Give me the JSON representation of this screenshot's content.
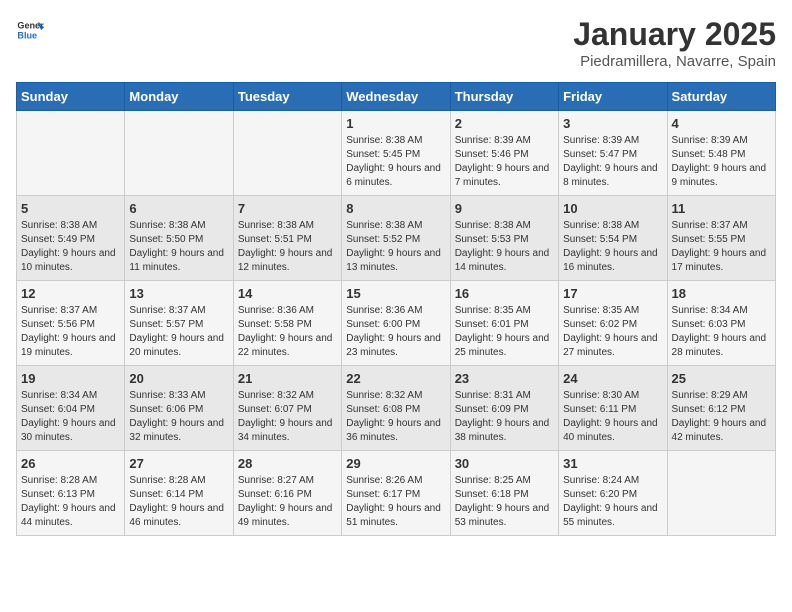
{
  "header": {
    "logo_general": "General",
    "logo_blue": "Blue",
    "title": "January 2025",
    "subtitle": "Piedramillera, Navarre, Spain"
  },
  "days_of_week": [
    "Sunday",
    "Monday",
    "Tuesday",
    "Wednesday",
    "Thursday",
    "Friday",
    "Saturday"
  ],
  "weeks": [
    [
      {
        "day": "",
        "sunrise": "",
        "sunset": "",
        "daylight": ""
      },
      {
        "day": "",
        "sunrise": "",
        "sunset": "",
        "daylight": ""
      },
      {
        "day": "",
        "sunrise": "",
        "sunset": "",
        "daylight": ""
      },
      {
        "day": "1",
        "sunrise": "Sunrise: 8:38 AM",
        "sunset": "Sunset: 5:45 PM",
        "daylight": "Daylight: 9 hours and 6 minutes."
      },
      {
        "day": "2",
        "sunrise": "Sunrise: 8:39 AM",
        "sunset": "Sunset: 5:46 PM",
        "daylight": "Daylight: 9 hours and 7 minutes."
      },
      {
        "day": "3",
        "sunrise": "Sunrise: 8:39 AM",
        "sunset": "Sunset: 5:47 PM",
        "daylight": "Daylight: 9 hours and 8 minutes."
      },
      {
        "day": "4",
        "sunrise": "Sunrise: 8:39 AM",
        "sunset": "Sunset: 5:48 PM",
        "daylight": "Daylight: 9 hours and 9 minutes."
      }
    ],
    [
      {
        "day": "5",
        "sunrise": "Sunrise: 8:38 AM",
        "sunset": "Sunset: 5:49 PM",
        "daylight": "Daylight: 9 hours and 10 minutes."
      },
      {
        "day": "6",
        "sunrise": "Sunrise: 8:38 AM",
        "sunset": "Sunset: 5:50 PM",
        "daylight": "Daylight: 9 hours and 11 minutes."
      },
      {
        "day": "7",
        "sunrise": "Sunrise: 8:38 AM",
        "sunset": "Sunset: 5:51 PM",
        "daylight": "Daylight: 9 hours and 12 minutes."
      },
      {
        "day": "8",
        "sunrise": "Sunrise: 8:38 AM",
        "sunset": "Sunset: 5:52 PM",
        "daylight": "Daylight: 9 hours and 13 minutes."
      },
      {
        "day": "9",
        "sunrise": "Sunrise: 8:38 AM",
        "sunset": "Sunset: 5:53 PM",
        "daylight": "Daylight: 9 hours and 14 minutes."
      },
      {
        "day": "10",
        "sunrise": "Sunrise: 8:38 AM",
        "sunset": "Sunset: 5:54 PM",
        "daylight": "Daylight: 9 hours and 16 minutes."
      },
      {
        "day": "11",
        "sunrise": "Sunrise: 8:37 AM",
        "sunset": "Sunset: 5:55 PM",
        "daylight": "Daylight: 9 hours and 17 minutes."
      }
    ],
    [
      {
        "day": "12",
        "sunrise": "Sunrise: 8:37 AM",
        "sunset": "Sunset: 5:56 PM",
        "daylight": "Daylight: 9 hours and 19 minutes."
      },
      {
        "day": "13",
        "sunrise": "Sunrise: 8:37 AM",
        "sunset": "Sunset: 5:57 PM",
        "daylight": "Daylight: 9 hours and 20 minutes."
      },
      {
        "day": "14",
        "sunrise": "Sunrise: 8:36 AM",
        "sunset": "Sunset: 5:58 PM",
        "daylight": "Daylight: 9 hours and 22 minutes."
      },
      {
        "day": "15",
        "sunrise": "Sunrise: 8:36 AM",
        "sunset": "Sunset: 6:00 PM",
        "daylight": "Daylight: 9 hours and 23 minutes."
      },
      {
        "day": "16",
        "sunrise": "Sunrise: 8:35 AM",
        "sunset": "Sunset: 6:01 PM",
        "daylight": "Daylight: 9 hours and 25 minutes."
      },
      {
        "day": "17",
        "sunrise": "Sunrise: 8:35 AM",
        "sunset": "Sunset: 6:02 PM",
        "daylight": "Daylight: 9 hours and 27 minutes."
      },
      {
        "day": "18",
        "sunrise": "Sunrise: 8:34 AM",
        "sunset": "Sunset: 6:03 PM",
        "daylight": "Daylight: 9 hours and 28 minutes."
      }
    ],
    [
      {
        "day": "19",
        "sunrise": "Sunrise: 8:34 AM",
        "sunset": "Sunset: 6:04 PM",
        "daylight": "Daylight: 9 hours and 30 minutes."
      },
      {
        "day": "20",
        "sunrise": "Sunrise: 8:33 AM",
        "sunset": "Sunset: 6:06 PM",
        "daylight": "Daylight: 9 hours and 32 minutes."
      },
      {
        "day": "21",
        "sunrise": "Sunrise: 8:32 AM",
        "sunset": "Sunset: 6:07 PM",
        "daylight": "Daylight: 9 hours and 34 minutes."
      },
      {
        "day": "22",
        "sunrise": "Sunrise: 8:32 AM",
        "sunset": "Sunset: 6:08 PM",
        "daylight": "Daylight: 9 hours and 36 minutes."
      },
      {
        "day": "23",
        "sunrise": "Sunrise: 8:31 AM",
        "sunset": "Sunset: 6:09 PM",
        "daylight": "Daylight: 9 hours and 38 minutes."
      },
      {
        "day": "24",
        "sunrise": "Sunrise: 8:30 AM",
        "sunset": "Sunset: 6:11 PM",
        "daylight": "Daylight: 9 hours and 40 minutes."
      },
      {
        "day": "25",
        "sunrise": "Sunrise: 8:29 AM",
        "sunset": "Sunset: 6:12 PM",
        "daylight": "Daylight: 9 hours and 42 minutes."
      }
    ],
    [
      {
        "day": "26",
        "sunrise": "Sunrise: 8:28 AM",
        "sunset": "Sunset: 6:13 PM",
        "daylight": "Daylight: 9 hours and 44 minutes."
      },
      {
        "day": "27",
        "sunrise": "Sunrise: 8:28 AM",
        "sunset": "Sunset: 6:14 PM",
        "daylight": "Daylight: 9 hours and 46 minutes."
      },
      {
        "day": "28",
        "sunrise": "Sunrise: 8:27 AM",
        "sunset": "Sunset: 6:16 PM",
        "daylight": "Daylight: 9 hours and 49 minutes."
      },
      {
        "day": "29",
        "sunrise": "Sunrise: 8:26 AM",
        "sunset": "Sunset: 6:17 PM",
        "daylight": "Daylight: 9 hours and 51 minutes."
      },
      {
        "day": "30",
        "sunrise": "Sunrise: 8:25 AM",
        "sunset": "Sunset: 6:18 PM",
        "daylight": "Daylight: 9 hours and 53 minutes."
      },
      {
        "day": "31",
        "sunrise": "Sunrise: 8:24 AM",
        "sunset": "Sunset: 6:20 PM",
        "daylight": "Daylight: 9 hours and 55 minutes."
      },
      {
        "day": "",
        "sunrise": "",
        "sunset": "",
        "daylight": ""
      }
    ]
  ]
}
